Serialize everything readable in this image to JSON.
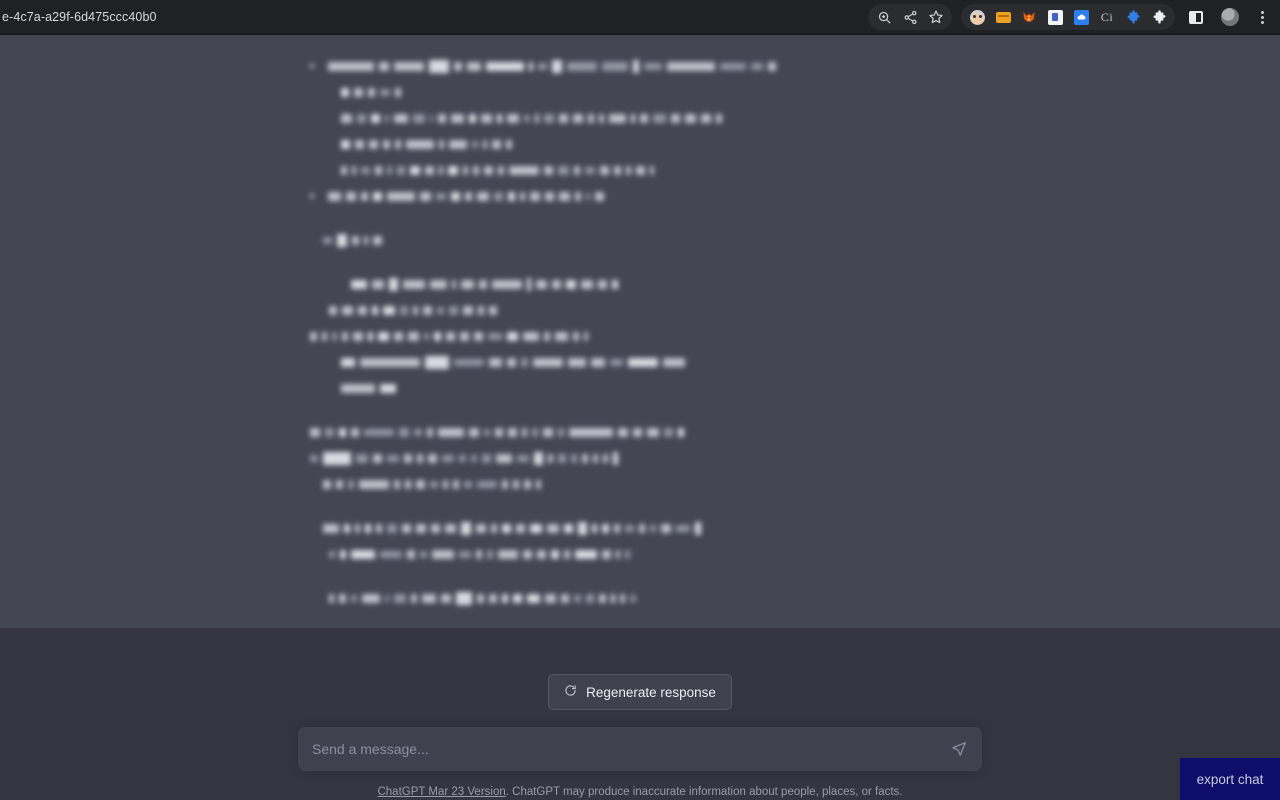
{
  "browser": {
    "omnibox_value": "e-4c7a-a29f-6d475ccc40b0",
    "toolbar_pill_icons": [
      {
        "name": "zoom-icon",
        "label": "Zoom"
      },
      {
        "name": "share-icon",
        "label": "Share"
      },
      {
        "name": "bookmark-star-icon",
        "label": "Bookmark this tab"
      }
    ],
    "extension_icons": [
      {
        "name": "face-extension-icon",
        "label": "Face extension"
      },
      {
        "name": "orange-card-extension-icon",
        "label": "Card extension"
      },
      {
        "name": "fox-extension-icon",
        "label": "Fox extension"
      },
      {
        "name": "document-extension-icon",
        "label": "Document extension"
      },
      {
        "name": "blue-cloud-extension-icon",
        "label": "Cloud extension"
      },
      {
        "name": "ci-extension-icon",
        "label": "Ci"
      },
      {
        "name": "blue-puzzle-extension-icon",
        "label": "Extension"
      },
      {
        "name": "white-puzzle-extensions-icon",
        "label": "Extensions"
      },
      {
        "name": "side-panel-icon",
        "label": "Side panel"
      },
      {
        "name": "profile-avatar-icon",
        "label": "Profile"
      },
      {
        "name": "chrome-menu-icon",
        "label": "Customize and control"
      }
    ],
    "ci_label": "Ci"
  },
  "chat": {
    "content_state": "blurred",
    "content_note": "Message body is visually redacted (blurred) in the screenshot; no legible text.",
    "blocks": [
      {
        "type": "bullet-list",
        "items": [
          {
            "lines": [
              {
                "indent": 0,
                "bullet": true,
                "tokens": [
                  46,
                  10,
                  30,
                  20,
                  8,
                  14,
                  38,
                  4,
                  9,
                  10,
                  30,
                  26,
                  6,
                  18,
                  48,
                  26,
                  12,
                  8
                ]
              },
              {
                "indent": 26,
                "bullet": false,
                "tokens": [
                  8,
                  9,
                  7,
                  10,
                  6
                ]
              }
            ]
          },
          {
            "lines": [
              {
                "indent": 26,
                "bullet": false,
                "tokens": [
                  11,
                  9,
                  9,
                  4,
                  14,
                  12,
                  3,
                  8,
                  13,
                  7,
                  11,
                  5,
                  12,
                  6,
                  4,
                  10,
                  9,
                  10,
                  6,
                  5,
                  17,
                  4,
                  8,
                  13,
                  9,
                  11,
                  10,
                  6
                ]
              },
              {
                "indent": 26,
                "bullet": false,
                "tokens": [
                  9,
                  9,
                  9,
                  7,
                  6,
                  28,
                  5,
                  18,
                  6,
                  4,
                  9,
                  6
                ]
              },
              {
                "indent": 26,
                "bullet": false,
                "tokens": [
                  6,
                  4,
                  9,
                  7,
                  5,
                  8,
                  10,
                  9,
                  4,
                  10,
                  5,
                  6,
                  9,
                  6,
                  30,
                  9,
                  11,
                  6,
                  10,
                  9,
                  7,
                  5,
                  9,
                  4
                ]
              }
            ]
          },
          {
            "lines": [
              {
                "indent": 0,
                "bullet": true,
                "tokens": [
                  13,
                  10,
                  7,
                  9,
                  28,
                  11,
                  10,
                  9,
                  7,
                  12,
                  9,
                  7,
                  5,
                  10,
                  9,
                  11,
                  6,
                  4,
                  9
                ]
              }
            ]
          }
        ]
      },
      {
        "type": "paragraph",
        "lines": [
          {
            "indent": 8,
            "bullet": false,
            "tokens": [
              9,
              10,
              7,
              4,
              9
            ]
          }
        ]
      },
      {
        "type": "paragraph",
        "lines": [
          {
            "indent": 36,
            "bullet": false,
            "tokens": [
              16,
              12,
              9,
              22,
              17,
              4,
              13,
              8,
              30,
              4,
              11,
              9,
              10,
              12,
              9,
              6
            ]
          },
          {
            "indent": 14,
            "bullet": false,
            "tokens": [
              8,
              11,
              9,
              6,
              12,
              8,
              5,
              9,
              7,
              9,
              10,
              6,
              8
            ]
          },
          {
            "indent": 0,
            "bullet": false,
            "tokens": [
              7,
              5,
              5,
              6,
              10,
              5,
              11,
              9,
              11,
              5,
              7,
              9,
              9,
              9,
              14,
              11,
              16,
              6,
              13,
              6,
              4
            ]
          },
          {
            "indent": 26,
            "bullet": false,
            "tokens": [
              14,
              60,
              24,
              30,
              13,
              9,
              7,
              30,
              18,
              14,
              13,
              30,
              22
            ]
          },
          {
            "indent": 26,
            "bullet": false,
            "tokens": [
              34,
              16
            ]
          }
        ]
      },
      {
        "type": "paragraph",
        "lines": [
          {
            "indent": 0,
            "bullet": false,
            "tokens": [
              10,
              9,
              7,
              8,
              30,
              10,
              8,
              6,
              26,
              10,
              6,
              8,
              9,
              5,
              6,
              10,
              6,
              44,
              10,
              9,
              12,
              9,
              6
            ]
          },
          {
            "indent": 0,
            "bullet": false,
            "tokens": [
              8,
              28,
              12,
              9,
              12,
              8,
              6,
              9,
              12,
              7,
              6,
              9,
              16,
              12,
              9,
              5,
              8,
              6,
              6,
              5,
              5,
              5
            ]
          },
          {
            "indent": 8,
            "bullet": false,
            "tokens": [
              8,
              7,
              6,
              30,
              6,
              6,
              9,
              8,
              5,
              6,
              8,
              20,
              6,
              6,
              7,
              5
            ]
          }
        ]
      },
      {
        "type": "paragraph",
        "lines": [
          {
            "indent": 8,
            "bullet": false,
            "tokens": [
              16,
              6,
              5,
              6,
              6,
              10,
              9,
              10,
              9,
              11,
              10,
              10,
              6,
              9,
              9,
              12,
              12,
              9,
              9,
              5,
              7,
              6,
              9,
              6,
              6,
              10,
              14,
              6
            ]
          },
          {
            "indent": 14,
            "bullet": false,
            "tokens": [
              6,
              6,
              24,
              22,
              8,
              7,
              22,
              12,
              6,
              6,
              20,
              9,
              9,
              8,
              6,
              22,
              9,
              4,
              5
            ]
          }
        ]
      },
      {
        "type": "paragraph",
        "lines": [
          {
            "indent": 14,
            "bullet": false,
            "tokens": [
              5,
              7,
              6,
              18,
              4,
              12,
              6,
              14,
              10,
              16,
              7,
              8,
              6,
              9,
              13,
              11,
              8,
              7,
              8,
              7,
              4,
              5,
              6
            ]
          }
        ]
      }
    ]
  },
  "composer": {
    "regenerate_label": "Regenerate response",
    "regenerate_icon": "refresh-icon",
    "input_placeholder": "Send a message...",
    "input_value": "",
    "send_icon": "send-paper-plane-icon"
  },
  "footer": {
    "version_link": "ChatGPT Mar 23 Version",
    "disclaimer": ". ChatGPT may produce inaccurate information about people, places, or facts."
  },
  "export": {
    "label": "export chat",
    "background_color": "#0d0d6b",
    "text_color": "#c9cbd8"
  },
  "colors": {
    "browser_chrome": "#202124",
    "assistant_message_bg": "#444654",
    "page_bg": "#343541",
    "input_bg": "#40414f",
    "text_primary": "#ececf1",
    "text_muted": "#8e8ea0"
  }
}
